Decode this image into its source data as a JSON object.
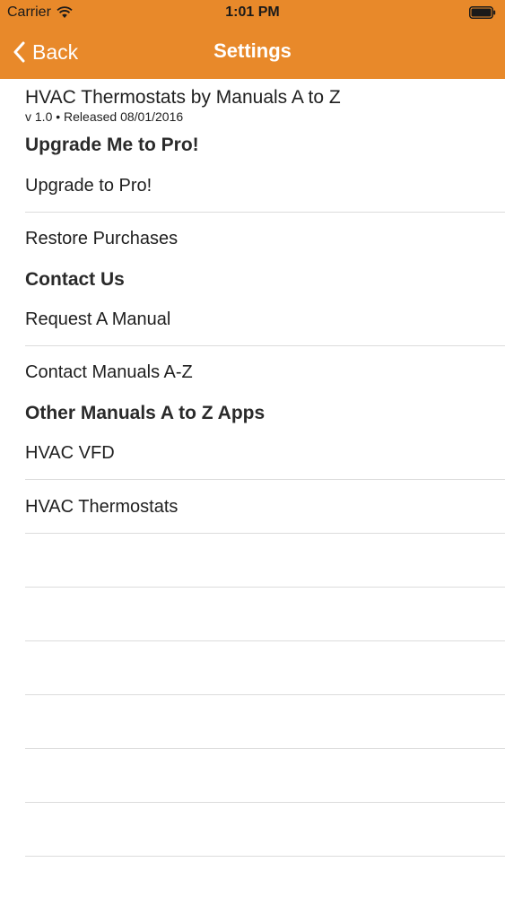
{
  "status_bar": {
    "carrier": "Carrier",
    "time": "1:01 PM",
    "wifi_icon": "wifi-icon",
    "battery_icon": "battery-icon"
  },
  "nav": {
    "back_label": "Back",
    "title": "Settings",
    "back_icon": "chevron-left-icon",
    "bar_color": "#E8892A"
  },
  "app": {
    "name": "HVAC Thermostats by Manuals A to Z",
    "version": "v 1.0 • Released 08/01/2016"
  },
  "sections": {
    "upgrade": {
      "header": "Upgrade Me to Pro!",
      "items": [
        "Upgrade to Pro!",
        "Restore Purchases"
      ]
    },
    "contact": {
      "header": "Contact Us",
      "items": [
        "Request A Manual",
        "Contact Manuals A-Z"
      ]
    },
    "other_apps": {
      "header": "Other Manuals A to Z Apps",
      "items": [
        "HVAC VFD",
        "HVAC Thermostats"
      ]
    }
  }
}
